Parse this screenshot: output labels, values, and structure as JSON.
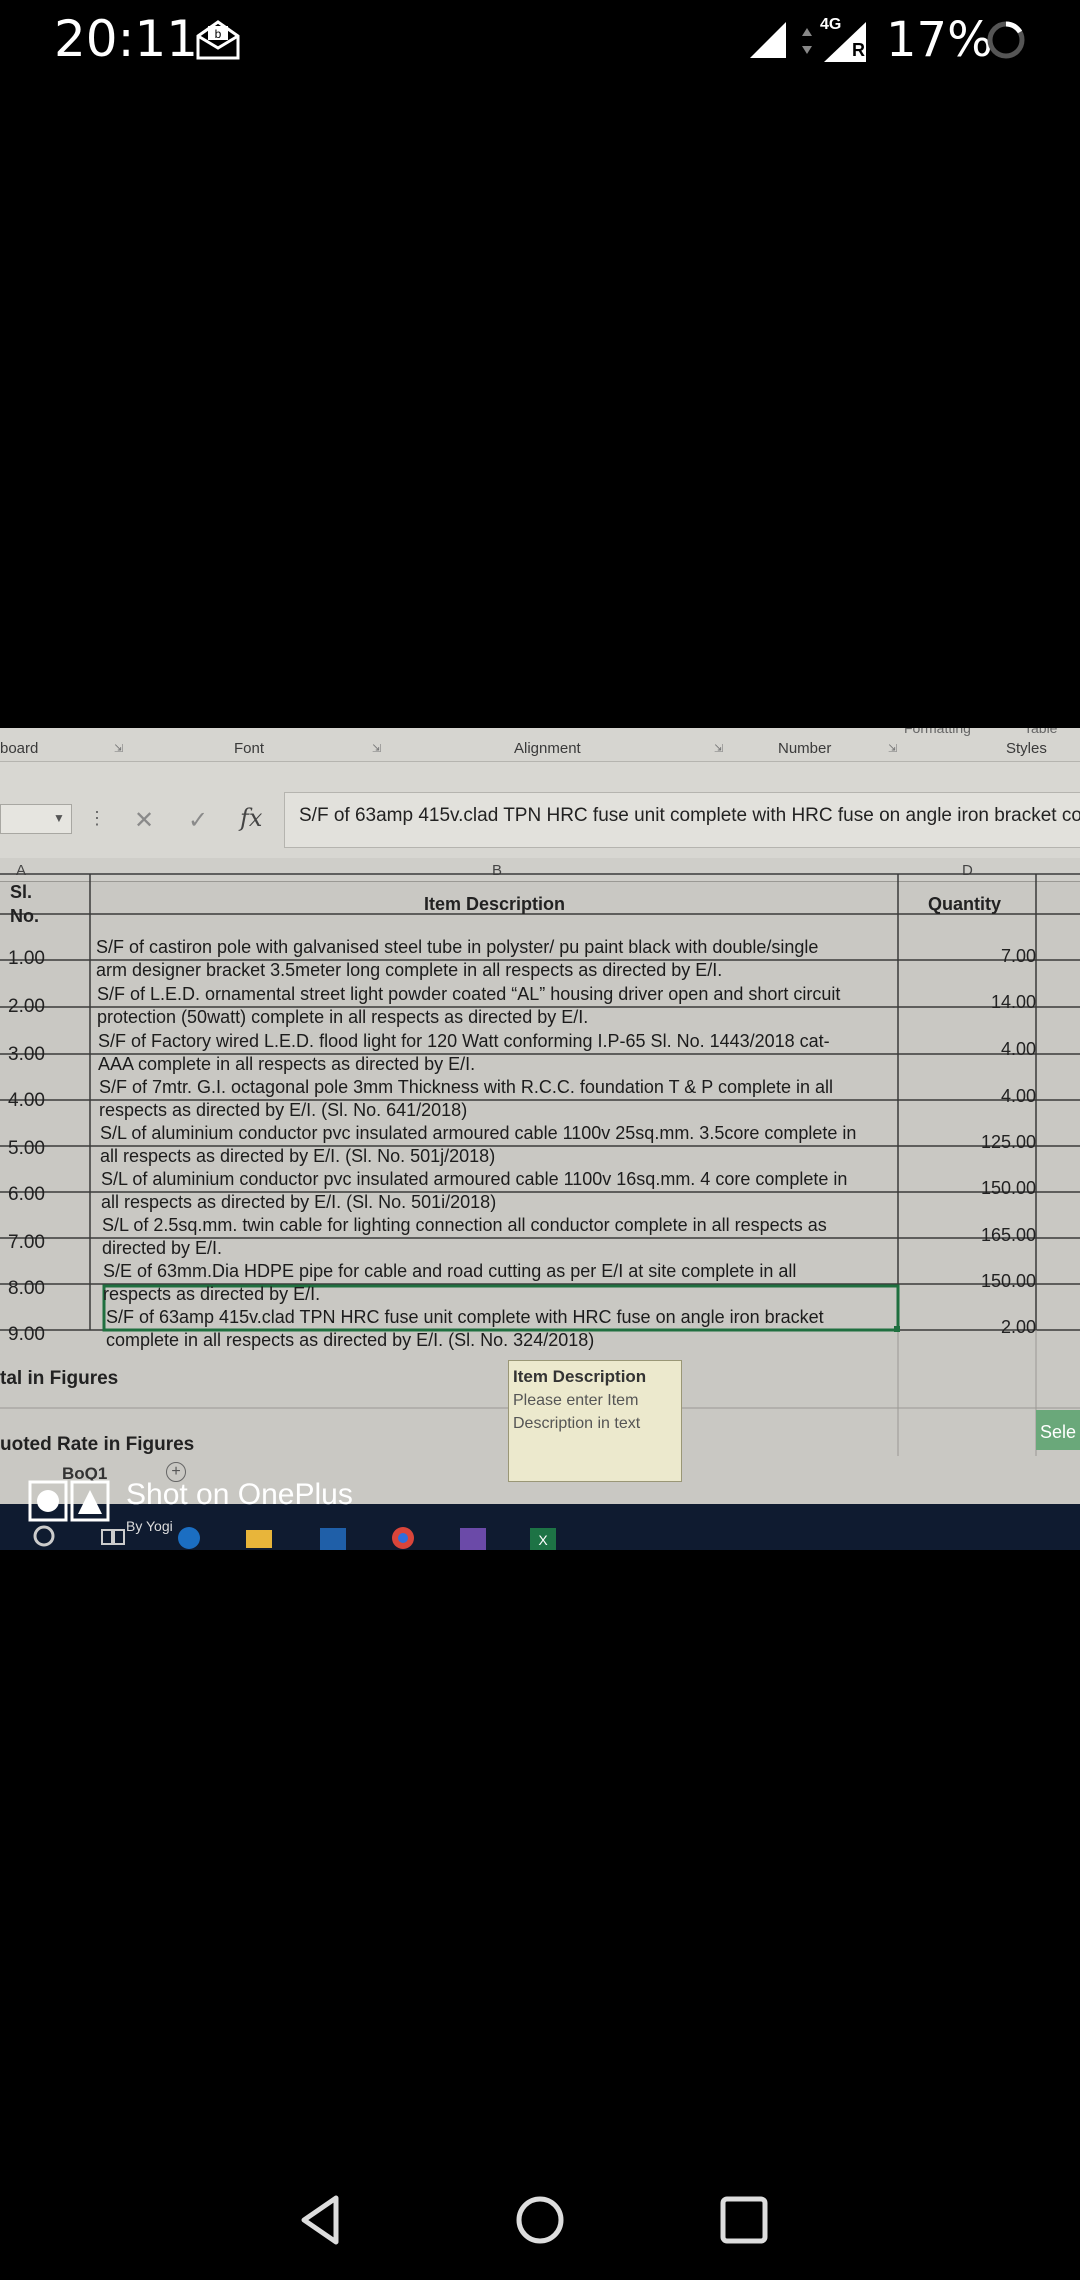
{
  "status_bar": {
    "time": "20:11",
    "network": "4G",
    "roaming": "R",
    "battery": "17%"
  },
  "ribbon": {
    "groups": [
      "board",
      "Font",
      "Alignment",
      "Number",
      "Styles"
    ],
    "top_fragments": [
      "Formatting",
      "Table"
    ]
  },
  "formula_bar": {
    "fx": "fx",
    "value": "S/F of 63amp 415v.clad TPN HRC fuse unit complete with HRC fuse on angle iron bracket co"
  },
  "columns": [
    "A",
    "B",
    "D"
  ],
  "table": {
    "header": {
      "sl_no_line1": "Sl.",
      "sl_no_line2": "No.",
      "description": "Item Description",
      "quantity": "Quantity"
    },
    "rows": [
      {
        "sl": "1.00",
        "line1": "S/F of castiron pole with galvanised steel tube in polyster/     pu paint black with double/single",
        "line2": "arm designer bracket 3.5meter long complete in all respects as directed by E/I.",
        "qty": "7.00"
      },
      {
        "sl": "2.00",
        "line1": "S/F of L.E.D. ornamental street light powder coated “AL” housing driver open and short circuit",
        "line2": "protection (50watt) complete in all respects as directed by E/I.",
        "qty": "14.00"
      },
      {
        "sl": "3.00",
        "line1": "S/F of Factory wired L.E.D. flood light for 120 Watt conforming I.P-65 Sl. No. 1443/2018 cat-",
        "line2": "AAA complete in all respects as directed by E/I.",
        "qty": "4.00"
      },
      {
        "sl": "4.00",
        "line1": "S/F of 7mtr. G.I. octagonal pole 3mm Thickness with R.C.C. foundation T & P  complete in all",
        "line2": "respects as directed by E/I. (Sl. No. 641/2018)",
        "qty": "4.00"
      },
      {
        "sl": "5.00",
        "line1": "S/L of aluminium conductor pvc insulated armoured cable 1100v 25sq.mm. 3.5core  complete in",
        "line2": "all respects as directed by E/I.  (Sl. No. 501j/2018)",
        "qty": "125.00"
      },
      {
        "sl": "6.00",
        "line1": "S/L of aluminium conductor pvc insulated armoured cable 1100v 16sq.mm. 4 core  complete in",
        "line2": "all respects as directed by E/I.  (Sl. No. 501i/2018)",
        "qty": "150.00"
      },
      {
        "sl": "7.00",
        "line1": "S/L of 2.5sq.mm. twin cable for lighting connection all conductor complete in all respects as",
        "line2": "directed by E/I.",
        "qty": "165.00"
      },
      {
        "sl": "8.00",
        "line1": "S/E of 63mm.Dia HDPE pipe for cable and road cutting as per E/I at site complete in all",
        "line2": "respects as directed by E/I.",
        "qty": "150.00"
      },
      {
        "sl": "9.00",
        "line1": "S/F of 63amp 415v.clad TPN HRC fuse unit complete with HRC fuse on angle iron bracket",
        "line2": "complete in all respects as directed by E/I. (Sl. No. 324/2018)",
        "qty": "2.00"
      }
    ],
    "total_label": "tal in Figures",
    "quoted_label": "uoted Rate in Figures",
    "select_text": "Sele"
  },
  "tooltip": {
    "title": "Item Description",
    "line1": "Please enter Item",
    "line2": "Description in text"
  },
  "sheet_tab": "BoQ1",
  "watermark": {
    "title": "Shot on OnePlus",
    "subtitle": "By Yogi"
  },
  "colors": {
    "background": "#000000",
    "paper": "#c9c8c3",
    "taskbar": "#0f1b30",
    "select_fill": "#6aa87a"
  }
}
